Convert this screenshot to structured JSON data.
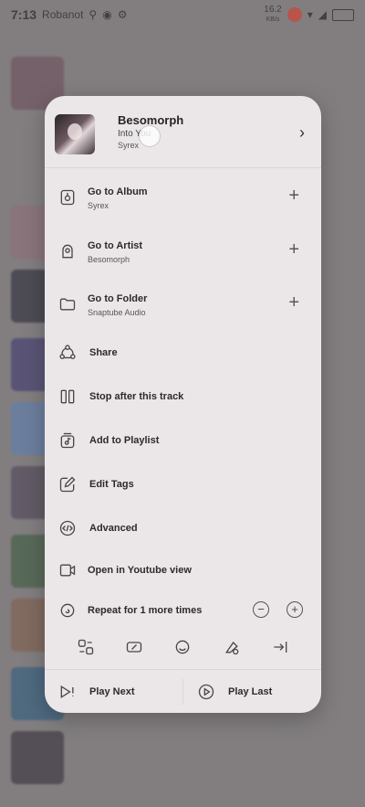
{
  "status_bar": {
    "time": "7:13",
    "notif_text": "Robanot",
    "speed": "16.2",
    "speed_unit": "KB/s"
  },
  "sheet": {
    "track": {
      "title": "Besomorph",
      "subtitle": "Into You",
      "album": "Syrex"
    },
    "menu": [
      {
        "label": "Go to Album",
        "sub": "Syrex",
        "icon": "album-icon",
        "action": "+"
      },
      {
        "label": "Go to Artist",
        "sub": "Besomorph",
        "icon": "artist-icon",
        "action": "+"
      },
      {
        "label": "Go to Folder",
        "sub": "Snaptube Audio",
        "icon": "folder-icon",
        "action": "+"
      },
      {
        "label": "Share",
        "icon": "share-icon"
      },
      {
        "label": "Stop after this track",
        "icon": "stop-after-icon"
      },
      {
        "label": "Add to Playlist",
        "icon": "playlist-add-icon"
      },
      {
        "label": "Edit Tags",
        "icon": "edit-tags-icon"
      },
      {
        "label": "Advanced",
        "icon": "advanced-icon"
      },
      {
        "label": "Open in Youtube view",
        "icon": "youtube-view-icon"
      },
      {
        "label": "Repeat for 1 more times",
        "icon": "repeat-icon",
        "minus": "−",
        "plus": "+"
      }
    ],
    "bottom": {
      "play_next": "Play Next",
      "play_last": "Play Last"
    }
  }
}
